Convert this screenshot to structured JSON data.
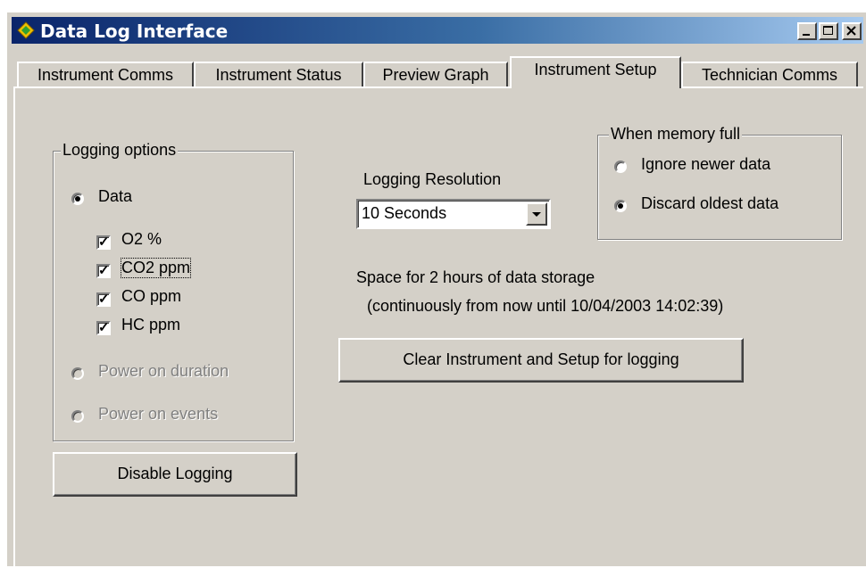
{
  "window": {
    "title": "Data Log Interface",
    "controls": [
      "minimize",
      "maximize",
      "close"
    ]
  },
  "tabs": [
    {
      "label": "Instrument Comms",
      "active": false
    },
    {
      "label": "Instrument Status",
      "active": false
    },
    {
      "label": "Preview Graph",
      "active": false
    },
    {
      "label": "Instrument Setup",
      "active": true
    },
    {
      "label": "Technician Comms",
      "active": false
    }
  ],
  "logging_options": {
    "legend": "Logging options",
    "data_radio": {
      "label": "Data",
      "selected": true
    },
    "channels": [
      {
        "label": "O2 %",
        "checked": true
      },
      {
        "label": "CO2 ppm",
        "checked": true
      },
      {
        "label": "CO ppm",
        "checked": true
      },
      {
        "label": "HC ppm",
        "checked": true
      }
    ],
    "power_on_duration": {
      "label": "Power on duration",
      "selected": false,
      "enabled": false
    },
    "power_on_events": {
      "label": "Power on events",
      "selected": false,
      "enabled": false
    }
  },
  "disable_button": "Disable Logging",
  "resolution": {
    "label": "Logging Resolution",
    "value": "10 Seconds"
  },
  "memory_full": {
    "legend": "When memory full",
    "ignore": {
      "label": "Ignore newer data",
      "selected": false
    },
    "discard": {
      "label": "Discard oldest data",
      "selected": true
    }
  },
  "storage": {
    "line1": "Space for 2 hours of data storage",
    "line2": "(continuously from now until 10/04/2003 14:02:39)"
  },
  "clear_button": "Clear Instrument and Setup for logging"
}
